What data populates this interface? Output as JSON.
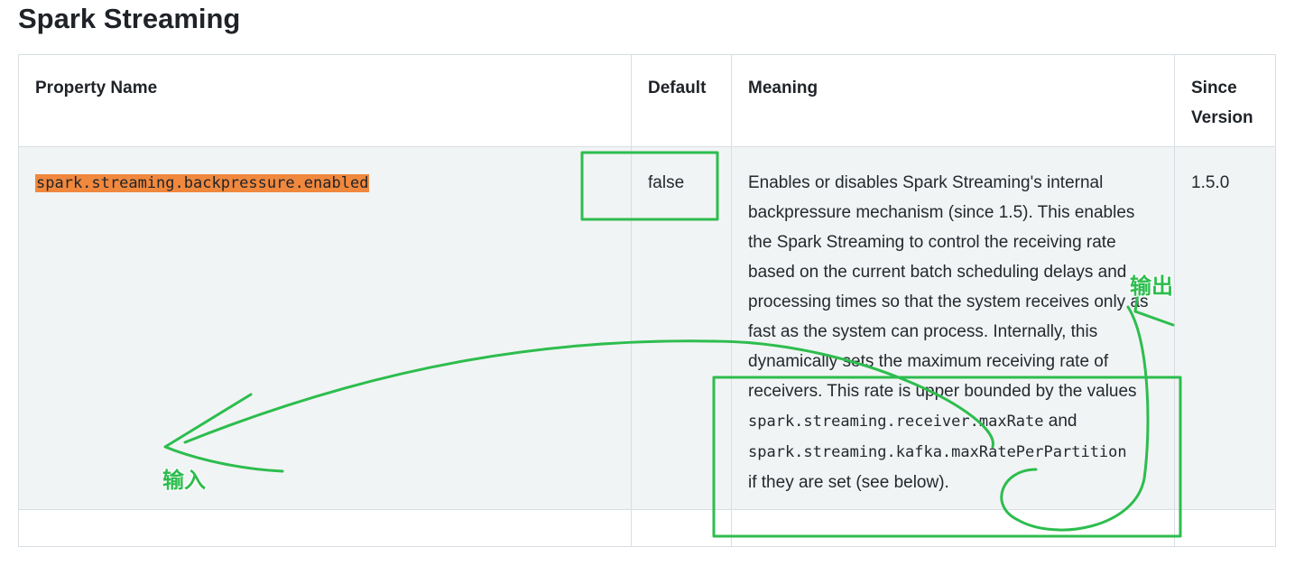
{
  "title": "Spark Streaming",
  "table": {
    "headers": {
      "property": "Property Name",
      "default": "Default",
      "meaning": "Meaning",
      "since_line1": "Since",
      "since_line2": "Version"
    },
    "row": {
      "property": "spark.streaming.backpressure.enabled",
      "default": "false",
      "meaning_text": "Enables or disables Spark Streaming's internal backpressure mechanism (since 1.5). This enables the Spark Streaming to control the receiving rate based on the current batch scheduling delays and processing times so that the system receives only as fast as the system can process. Internally, this dynamically sets the maximum receiving rate of receivers. This rate is upper bounded by the values",
      "code1": "spark.streaming.receiver.maxRate",
      "and_text": "and",
      "code2": "spark.streaming.kafka.maxRatePerPartition",
      "tail_text": "if they are set (see below).",
      "since": "1.5.0"
    }
  },
  "annotations": {
    "input_label": "输入",
    "output_label": "输出",
    "color": "#2dbd4e"
  }
}
